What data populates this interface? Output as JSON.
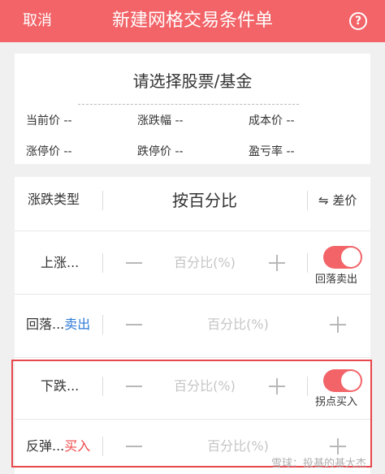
{
  "header": {
    "cancel": "取消",
    "title": "新建网格交易条件单",
    "help": "?"
  },
  "stock": {
    "placeholder": "请选择股票/基金",
    "info": [
      {
        "label": "当前价 --"
      },
      {
        "label": "涨跌幅 --"
      },
      {
        "label": "成本价 --"
      },
      {
        "label": "涨停价 --"
      },
      {
        "label": "跌停价 --"
      },
      {
        "label": "盈亏率 --"
      }
    ]
  },
  "table": {
    "type_label": "涨跌类型",
    "mode": "按百分比",
    "switch_label": "⇋ 差价",
    "pct_placeholder": "百分比(%)",
    "rows": [
      {
        "label": "上涨...",
        "action": "",
        "toggle_on": true,
        "toggle_caption": "回落卖出"
      },
      {
        "label": "回落...",
        "action": "卖出"
      },
      {
        "label": "下跌...",
        "action": "",
        "toggle_on": true,
        "toggle_caption": "拐点买入"
      },
      {
        "label": "反弹...",
        "action": "买入"
      }
    ]
  },
  "watermark": "雪球：投基的基大杰",
  "colors": {
    "brand": "#f26468",
    "sell": "#2e7bd8",
    "buy": "#f04848"
  }
}
